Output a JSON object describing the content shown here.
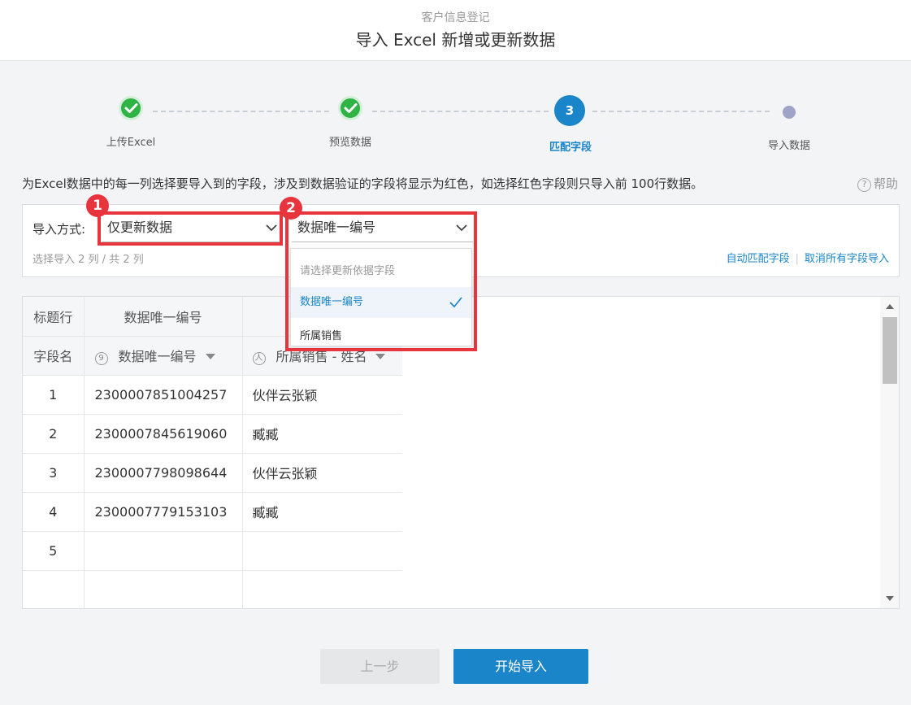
{
  "header": {
    "subtitle": "客户信息登记",
    "title": "导入 Excel 新增或更新数据"
  },
  "steps": [
    {
      "label": "上传Excel",
      "state": "done"
    },
    {
      "label": "预览数据",
      "state": "done"
    },
    {
      "label": "匹配字段",
      "state": "current",
      "number": "3"
    },
    {
      "label": "导入数据",
      "state": "pending"
    }
  ],
  "instruction": "为Excel数据中的每一列选择要导入到的字段，涉及到数据验证的字段将显示为红色，如选择红色字段则只导入前 100行数据。",
  "help_label": "帮助",
  "help_icon": "?",
  "config": {
    "import_mode_label": "导入方式:",
    "import_mode_value": "仅更新数据",
    "match_field_value": "数据唯一编号",
    "summary": "选择导入 2 列 / 共 2 列",
    "auto_match_link": "自动匹配字段",
    "cancel_all_link": "取消所有字段导入"
  },
  "annotations": {
    "badge1": "1",
    "badge2": "2",
    "color": "#e8343d"
  },
  "dropdown": {
    "placeholder": "请选择更新依据字段",
    "options": [
      {
        "label": "数据唯一编号",
        "selected": true
      },
      {
        "label": "所属销售",
        "selected": false
      }
    ]
  },
  "table": {
    "header_row_label": "标题行",
    "field_row_label": "字段名",
    "title_cols": [
      "数据唯一编号",
      ""
    ],
    "field_cols": [
      {
        "icon": "9",
        "name": "数据唯一编号"
      },
      {
        "icon": "人",
        "name": "所属销售 - 姓名"
      }
    ],
    "rows": [
      {
        "n": "1",
        "a": "2300007851004257",
        "b": "伙伴云张颖"
      },
      {
        "n": "2",
        "a": "2300007845619060",
        "b": "臧臧"
      },
      {
        "n": "3",
        "a": "2300007798098644",
        "b": "伙伴云张颖"
      },
      {
        "n": "4",
        "a": "2300007779153103",
        "b": "臧臧"
      },
      {
        "n": "5",
        "a": "",
        "b": ""
      },
      {
        "n": "",
        "a": "",
        "b": ""
      }
    ]
  },
  "buttons": {
    "prev": "上一步",
    "start": "开始导入"
  },
  "colors": {
    "accent": "#1a85c8",
    "done": "#2fb344",
    "pending": "#9fa3c7"
  }
}
